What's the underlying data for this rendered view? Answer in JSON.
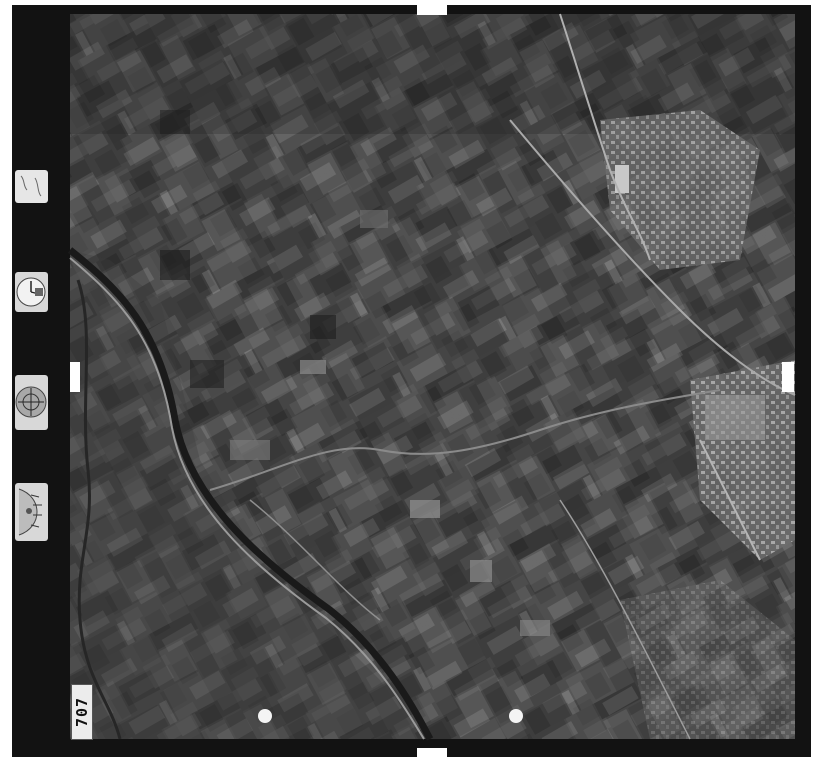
{
  "photo": {
    "frame_number": "707",
    "palette": {
      "frame": "#121212",
      "field_dark": "#2e2e2e",
      "field_mid": "#474747",
      "field_light": "#7a7a7a",
      "road": "#a9a9a9",
      "built_up": "#bdbdbd"
    },
    "instrument_icons": [
      "clock-dial-icon",
      "altimeter-crosshair-icon",
      "level-gauge-icon"
    ]
  }
}
